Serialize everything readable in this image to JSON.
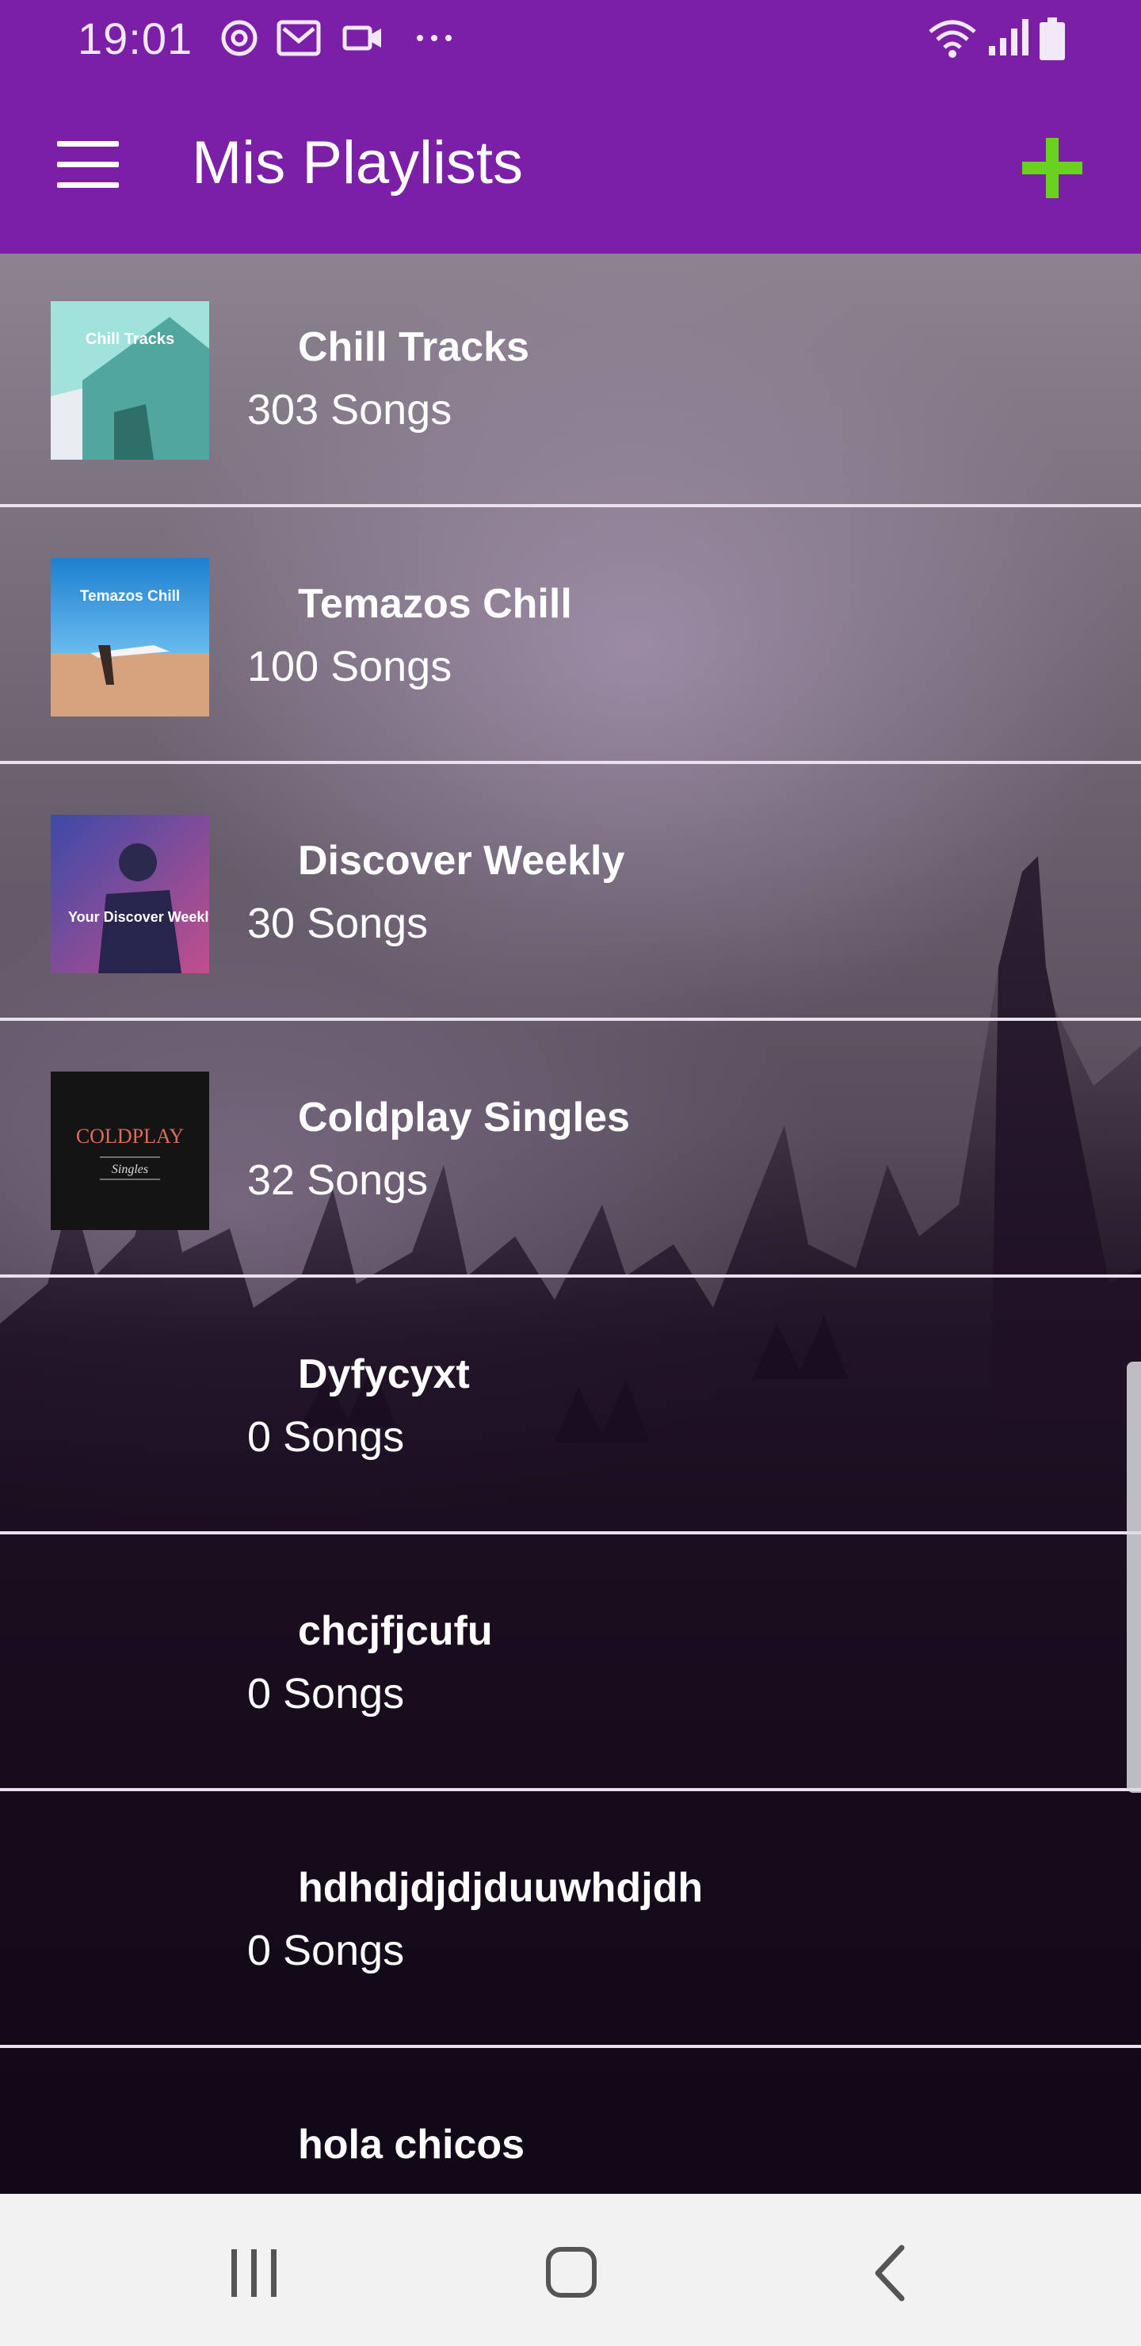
{
  "status_bar": {
    "time": "19:01",
    "icons": [
      "sync-icon",
      "mail-icon",
      "video-icon",
      "more-dots-icon",
      "wifi-icon",
      "signal-icon",
      "battery-icon"
    ]
  },
  "app_bar": {
    "title": "Mis Playlists",
    "menu_icon": "hamburger-menu-icon",
    "add_icon": "plus-icon"
  },
  "playlists": [
    {
      "name": "Chill Tracks",
      "count": "303 Songs",
      "cover_text": "Chill Tracks"
    },
    {
      "name": "Temazos Chill",
      "count": "100 Songs",
      "cover_text": "Temazos Chill"
    },
    {
      "name": "Discover Weekly",
      "count": "30 Songs",
      "cover_text": "Your Discover Weekly"
    },
    {
      "name": "Coldplay Singles",
      "count": "32 Songs",
      "cover_text": "COLDPLAY",
      "cover_subtext": "Singles"
    },
    {
      "name": "Dyfycyxt",
      "count": "0 Songs"
    },
    {
      "name": "chcjfjcufu",
      "count": "0 Songs"
    },
    {
      "name": "hdhdjdjdjduuwhdjdh",
      "count": "0 Songs"
    },
    {
      "name": "hola chicos",
      "count": ""
    }
  ],
  "nav_bar": {
    "icons": [
      "recent-apps-icon",
      "home-icon",
      "back-icon"
    ]
  },
  "colors": {
    "app_bar": "#7a1fa6",
    "add_button": "#6ad11e",
    "divider": "#e9e2ec",
    "nav_bar": "#f2f2f2"
  }
}
